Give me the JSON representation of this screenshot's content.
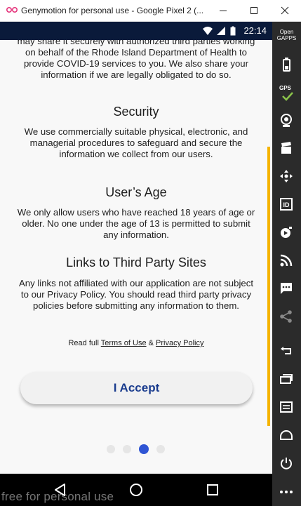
{
  "window": {
    "title": "Genymotion for personal use - Google Pixel 2 (..."
  },
  "status_bar": {
    "time": "22:14"
  },
  "policy": {
    "intro_text": "may share it securely with authorized third parties working on behalf of the Rhode Island Department of Health to provide COVID-19 services to you. We also share your information if we are legally obligated to do so.",
    "sections": [
      {
        "heading": "Security",
        "body": "We use commercially suitable physical, electronic, and managerial procedures to safeguard and secure the information we collect from our users."
      },
      {
        "heading": "User’s Age",
        "body": "We only allow users who have reached 18 years of age or older. No one under the age of 13 is permitted to submit any information."
      },
      {
        "heading": "Links to Third Party Sites",
        "body": "Any links not affiliated with our application are not subject to our Privacy Policy. You should read third party privacy policies before submitting any information to them."
      }
    ],
    "legal_prefix": "Read full",
    "terms_link": "Terms of Use",
    "legal_amp": "&",
    "privacy_link": "Privacy Policy"
  },
  "accept_button": {
    "label": "I Accept"
  },
  "pager": {
    "total": 4,
    "active_index": 2
  },
  "sidebar": {
    "open_gapps_label_line1": "Open",
    "open_gapps_label_line2": "GAPPS",
    "gps_label": "GPS"
  },
  "watermark": "free for personal use",
  "colors": {
    "accent_yellow": "#f5b400",
    "button_text": "#1a3c8e",
    "dot_active": "#2f55d4",
    "dot_inactive": "#e6e6e6",
    "status_bar": "#0a1a3a",
    "sidebar": "#2b2b2b"
  }
}
